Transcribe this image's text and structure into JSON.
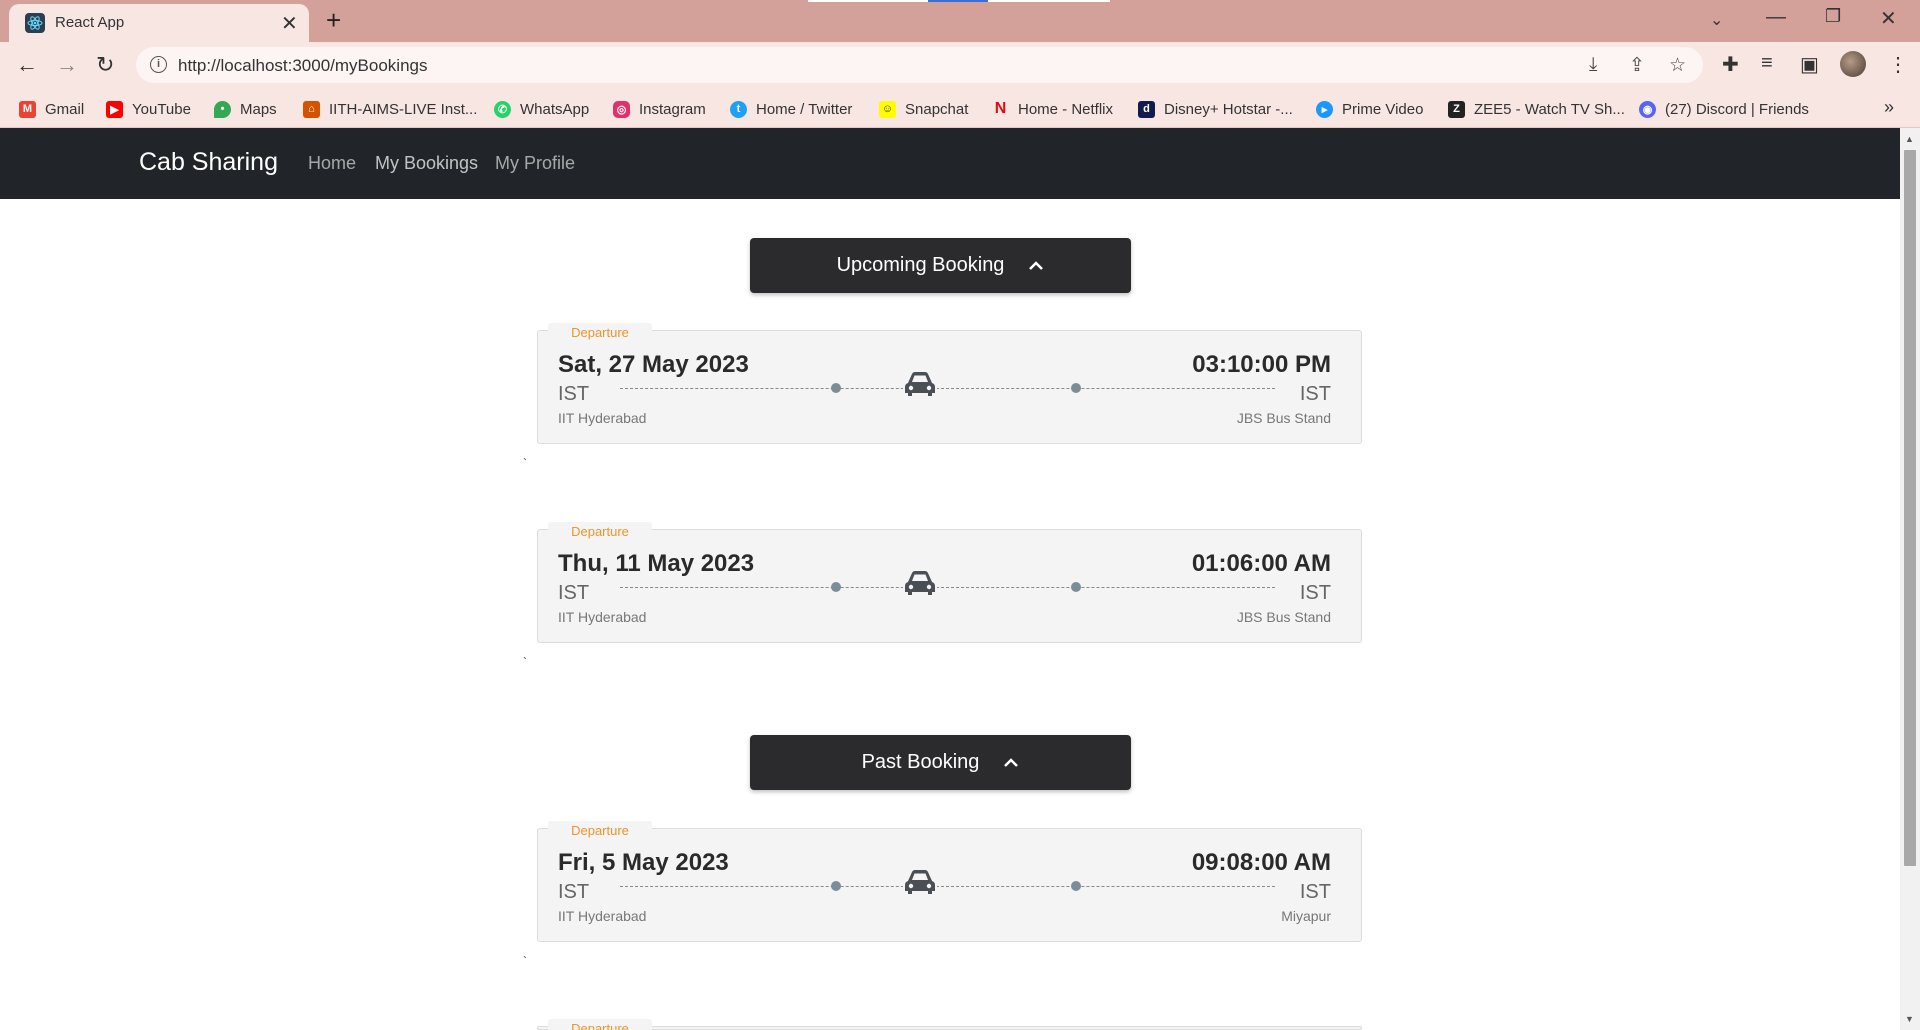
{
  "browser": {
    "tab_title": "React App",
    "url": "http://localhost:3000/myBookings",
    "bookmarks": [
      {
        "label": "Gmail",
        "icon": "gmail-icon",
        "color": "#ea4335"
      },
      {
        "label": "YouTube",
        "icon": "youtube-icon",
        "color": "#ff0000"
      },
      {
        "label": "Maps",
        "icon": "maps-icon",
        "color": "#34a853"
      },
      {
        "label": "IITH-AIMS-LIVE Inst...",
        "icon": "aims-icon",
        "color": "#d35400"
      },
      {
        "label": "WhatsApp",
        "icon": "whatsapp-icon",
        "color": "#25d366"
      },
      {
        "label": "Instagram",
        "icon": "instagram-icon",
        "color": "#e1306c"
      },
      {
        "label": "Home / Twitter",
        "icon": "twitter-icon",
        "color": "#1da1f2"
      },
      {
        "label": "Snapchat",
        "icon": "snapchat-icon",
        "color": "#fffc00"
      },
      {
        "label": "Home - Netflix",
        "icon": "netflix-icon",
        "color": "#e50914"
      },
      {
        "label": "Disney+ Hotstar -...",
        "icon": "hotstar-icon",
        "color": "#0f1c4d"
      },
      {
        "label": "Prime Video",
        "icon": "prime-video-icon",
        "color": "#1a98ff"
      },
      {
        "label": "ZEE5 - Watch TV Sh...",
        "icon": "zee5-icon",
        "color": "#222222"
      },
      {
        "label": "(27) Discord | Friends",
        "icon": "discord-icon",
        "color": "#5865f2"
      }
    ]
  },
  "app": {
    "brand": "Cab Sharing",
    "nav": [
      "Home",
      "My Bookings",
      "My Profile"
    ],
    "upcoming_label": "Upcoming Booking",
    "past_label": "Past Booking"
  },
  "bookings": {
    "upcoming": [
      {
        "tag": "Departure",
        "date": "Sat, 27 May 2023",
        "time": "03:10:00 PM",
        "tz_left": "IST",
        "tz_right": "IST",
        "from": "IIT Hyderabad",
        "to": "JBS Bus Stand"
      },
      {
        "tag": "Departure",
        "date": "Thu, 11 May 2023",
        "time": "01:06:00 AM",
        "tz_left": "IST",
        "tz_right": "IST",
        "from": "IIT Hyderabad",
        "to": "JBS Bus Stand"
      }
    ],
    "past": [
      {
        "tag": "Departure",
        "date": "Fri, 5 May 2023",
        "time": "09:08:00 AM",
        "tz_left": "IST",
        "tz_right": "IST",
        "from": "IIT Hyderabad",
        "to": "Miyapur"
      },
      {
        "tag": "Departure"
      }
    ]
  },
  "separator_mark": "`",
  "colors": {
    "tabstrip": "#d4a19a",
    "navbar": "#212529",
    "section_button": "#2b2b2d",
    "departure_tag": "#f0932b",
    "card_bg": "#f4f4f4"
  }
}
